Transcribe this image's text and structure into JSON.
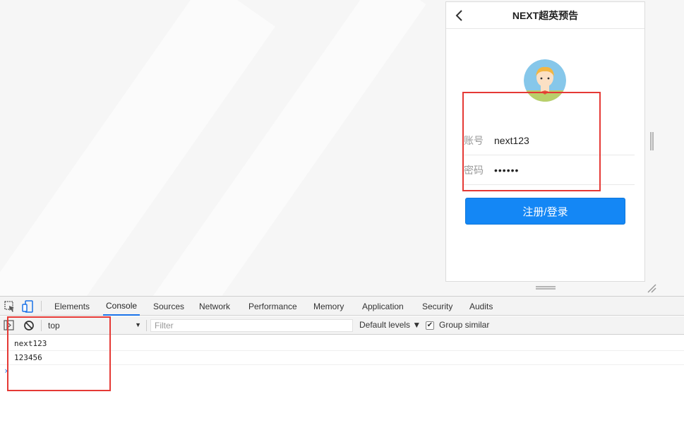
{
  "device": {
    "title": "NEXT超英预告",
    "account_label": "账号",
    "account_value": "next123",
    "password_label": "密码",
    "password_value": "••••••",
    "login_button": "注册/登录"
  },
  "devtools": {
    "tabs": [
      "Elements",
      "Console",
      "Sources",
      "Network",
      "Performance",
      "Memory",
      "Application",
      "Security",
      "Audits"
    ],
    "active_tab": "Console",
    "context": "top",
    "filter_placeholder": "Filter",
    "levels": "Default levels ▼",
    "group_similar": "Group similar",
    "group_similar_checked": true,
    "console_lines": [
      "next123",
      "123456"
    ]
  },
  "colors": {
    "primary": "#1487f5",
    "highlight": "#e53935",
    "active_tab": "#1a73e8"
  }
}
